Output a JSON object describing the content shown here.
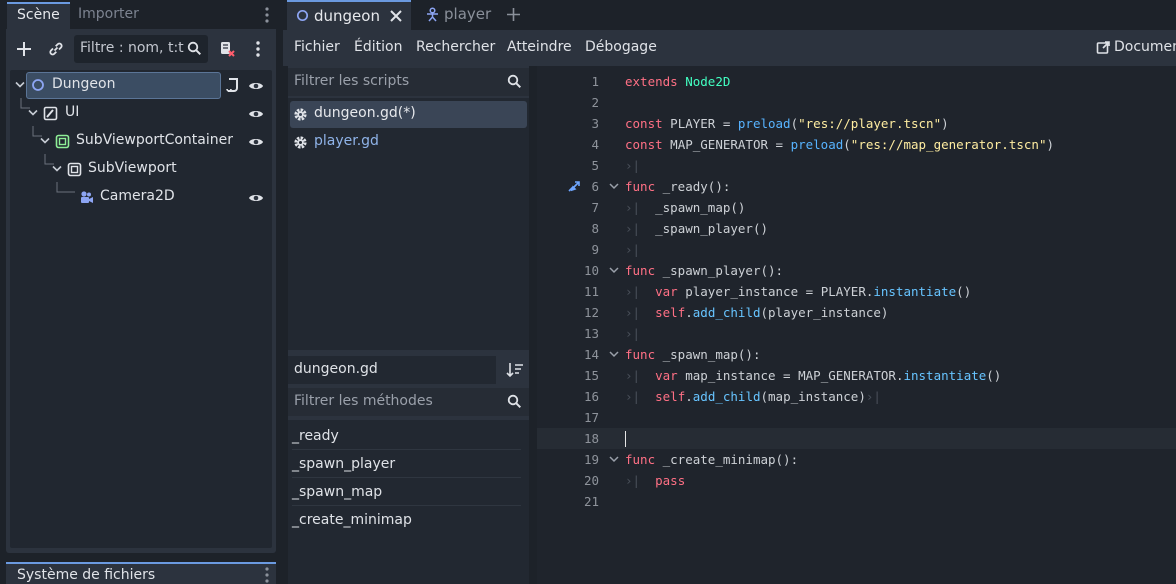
{
  "left_dock": {
    "tabs": [
      {
        "label": "Scène"
      },
      {
        "label": "Importer"
      }
    ],
    "filter_placeholder": "Filtre : nom, t:ty",
    "tree": [
      {
        "label": "Dungeon",
        "icon": "node2d-icon",
        "indent": 0,
        "selected": true,
        "visible_toggle": true
      },
      {
        "label": "UI",
        "icon": "control-icon",
        "indent": 1,
        "visible_toggle": true
      },
      {
        "label": "SubViewportContainer",
        "icon": "subviewportcontainer-icon",
        "indent": 2,
        "visible_toggle": true
      },
      {
        "label": "SubViewport",
        "icon": "subviewport-icon",
        "indent": 3,
        "visible_toggle": false
      },
      {
        "label": "Camera2D",
        "icon": "camera2d-icon",
        "indent": 4,
        "visible_toggle": true
      }
    ],
    "filesystem_tab": "Système de fichiers"
  },
  "editor_tabs": [
    {
      "label": "dungeon",
      "icon": "node2d-icon",
      "active": true
    },
    {
      "label": "player",
      "icon": "character-icon",
      "active": false
    }
  ],
  "menu": {
    "items": [
      "Fichier",
      "Édition",
      "Rechercher",
      "Atteindre",
      "Débogage"
    ],
    "docs": "Documentation en ligne"
  },
  "scripts": {
    "filter_placeholder": "Filtrer les scripts",
    "items": [
      {
        "label": "dungeon.gd(*)",
        "selected": true
      },
      {
        "label": "player.gd",
        "selected": false
      }
    ],
    "current_name": "dungeon.gd",
    "methods_filter_placeholder": "Filtrer les méthodes",
    "methods": [
      "_ready",
      "_spawn_player",
      "_spawn_map",
      "_create_minimap"
    ]
  },
  "code": {
    "current_line": 18,
    "lines": [
      {
        "n": "1",
        "text": "extends Node2D"
      },
      {
        "n": "2",
        "text": ""
      },
      {
        "n": "3",
        "text": "const PLAYER = preload(\"res://player.tscn\")"
      },
      {
        "n": "4",
        "text": "const MAP_GENERATOR = preload(\"res://map_generator.tscn\")"
      },
      {
        "n": "5",
        "text": ""
      },
      {
        "n": "6",
        "text": "func _ready():"
      },
      {
        "n": "7",
        "text": "_spawn_map()"
      },
      {
        "n": "8",
        "text": "_spawn_player()"
      },
      {
        "n": "9",
        "text": ""
      },
      {
        "n": "10",
        "text": "func _spawn_player():"
      },
      {
        "n": "11",
        "text": "var player_instance = PLAYER.instantiate()"
      },
      {
        "n": "12",
        "text": "self.add_child(player_instance)"
      },
      {
        "n": "13",
        "text": ""
      },
      {
        "n": "14",
        "text": "func _spawn_map():"
      },
      {
        "n": "15",
        "text": "var map_instance = MAP_GENERATOR.instantiate()"
      },
      {
        "n": "16",
        "text": "self.add_child(map_instance)"
      },
      {
        "n": "17",
        "text": ""
      },
      {
        "n": "18",
        "text": ""
      },
      {
        "n": "19",
        "text": "func _create_minimap():"
      },
      {
        "n": "20",
        "text": "pass"
      },
      {
        "n": "21",
        "text": ""
      }
    ]
  },
  "colors": {
    "accent": "#6b9ae0",
    "keyword": "#ff7085",
    "type": "#42ffc2",
    "string": "#ffeda1",
    "function": "#57b3ff"
  }
}
